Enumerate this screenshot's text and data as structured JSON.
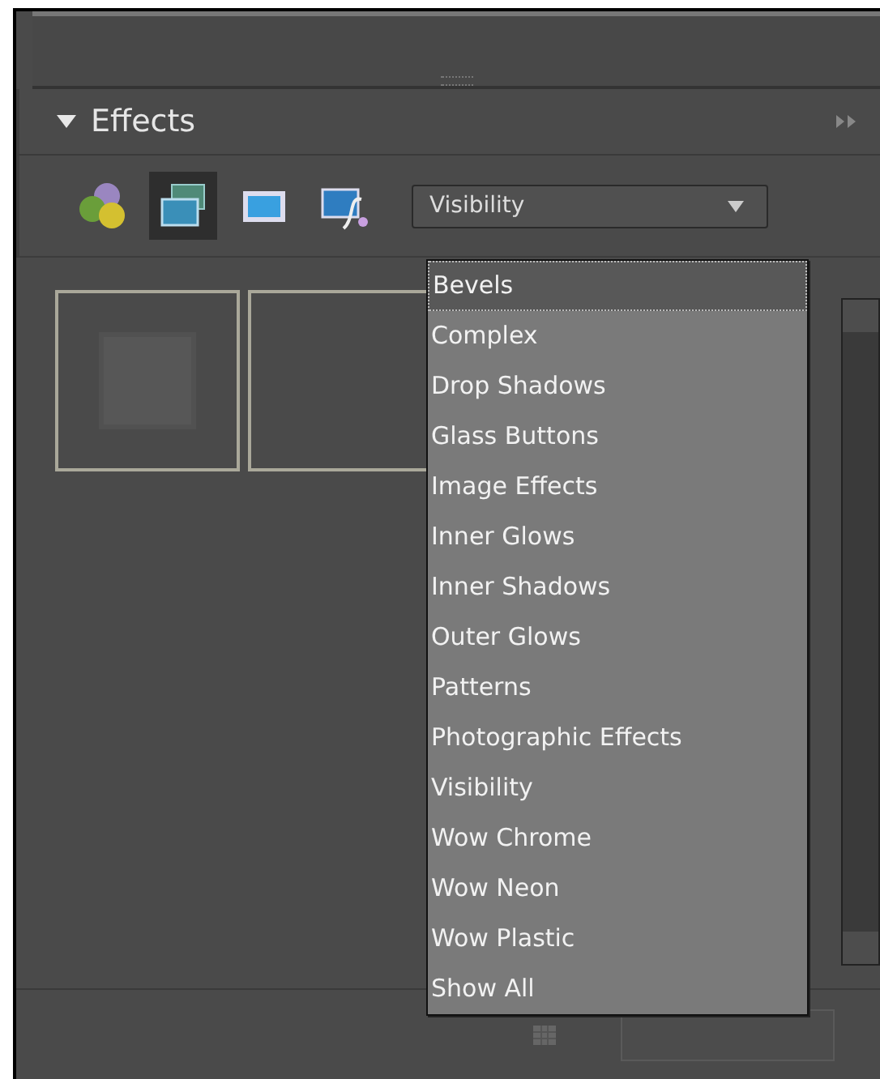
{
  "panel": {
    "title": "Effects",
    "expanded": true
  },
  "effect_tabs": [
    {
      "kind": "circles",
      "selected": false
    },
    {
      "kind": "layers",
      "selected": true
    },
    {
      "kind": "frame",
      "selected": false
    },
    {
      "kind": "fx",
      "selected": false
    }
  ],
  "category_dropdown": {
    "value": "Visibility"
  },
  "dropdown_menu": [
    {
      "label": "Bevels",
      "selected": true
    },
    {
      "label": "Complex",
      "selected": false
    },
    {
      "label": "Drop Shadows",
      "selected": false
    },
    {
      "label": "Glass Buttons",
      "selected": false
    },
    {
      "label": "Image Effects",
      "selected": false
    },
    {
      "label": "Inner Glows",
      "selected": false
    },
    {
      "label": "Inner Shadows",
      "selected": false
    },
    {
      "label": "Outer Glows",
      "selected": false
    },
    {
      "label": "Patterns",
      "selected": false
    },
    {
      "label": "Photographic Effects",
      "selected": false
    },
    {
      "label": "Visibility",
      "selected": false
    },
    {
      "label": "Wow Chrome",
      "selected": false
    },
    {
      "label": "Wow Neon",
      "selected": false
    },
    {
      "label": "Wow Plastic",
      "selected": false
    },
    {
      "label": "Show All",
      "selected": false
    }
  ],
  "thumbnails": [
    {
      "kind": "inner-square"
    },
    {
      "kind": "empty"
    }
  ]
}
